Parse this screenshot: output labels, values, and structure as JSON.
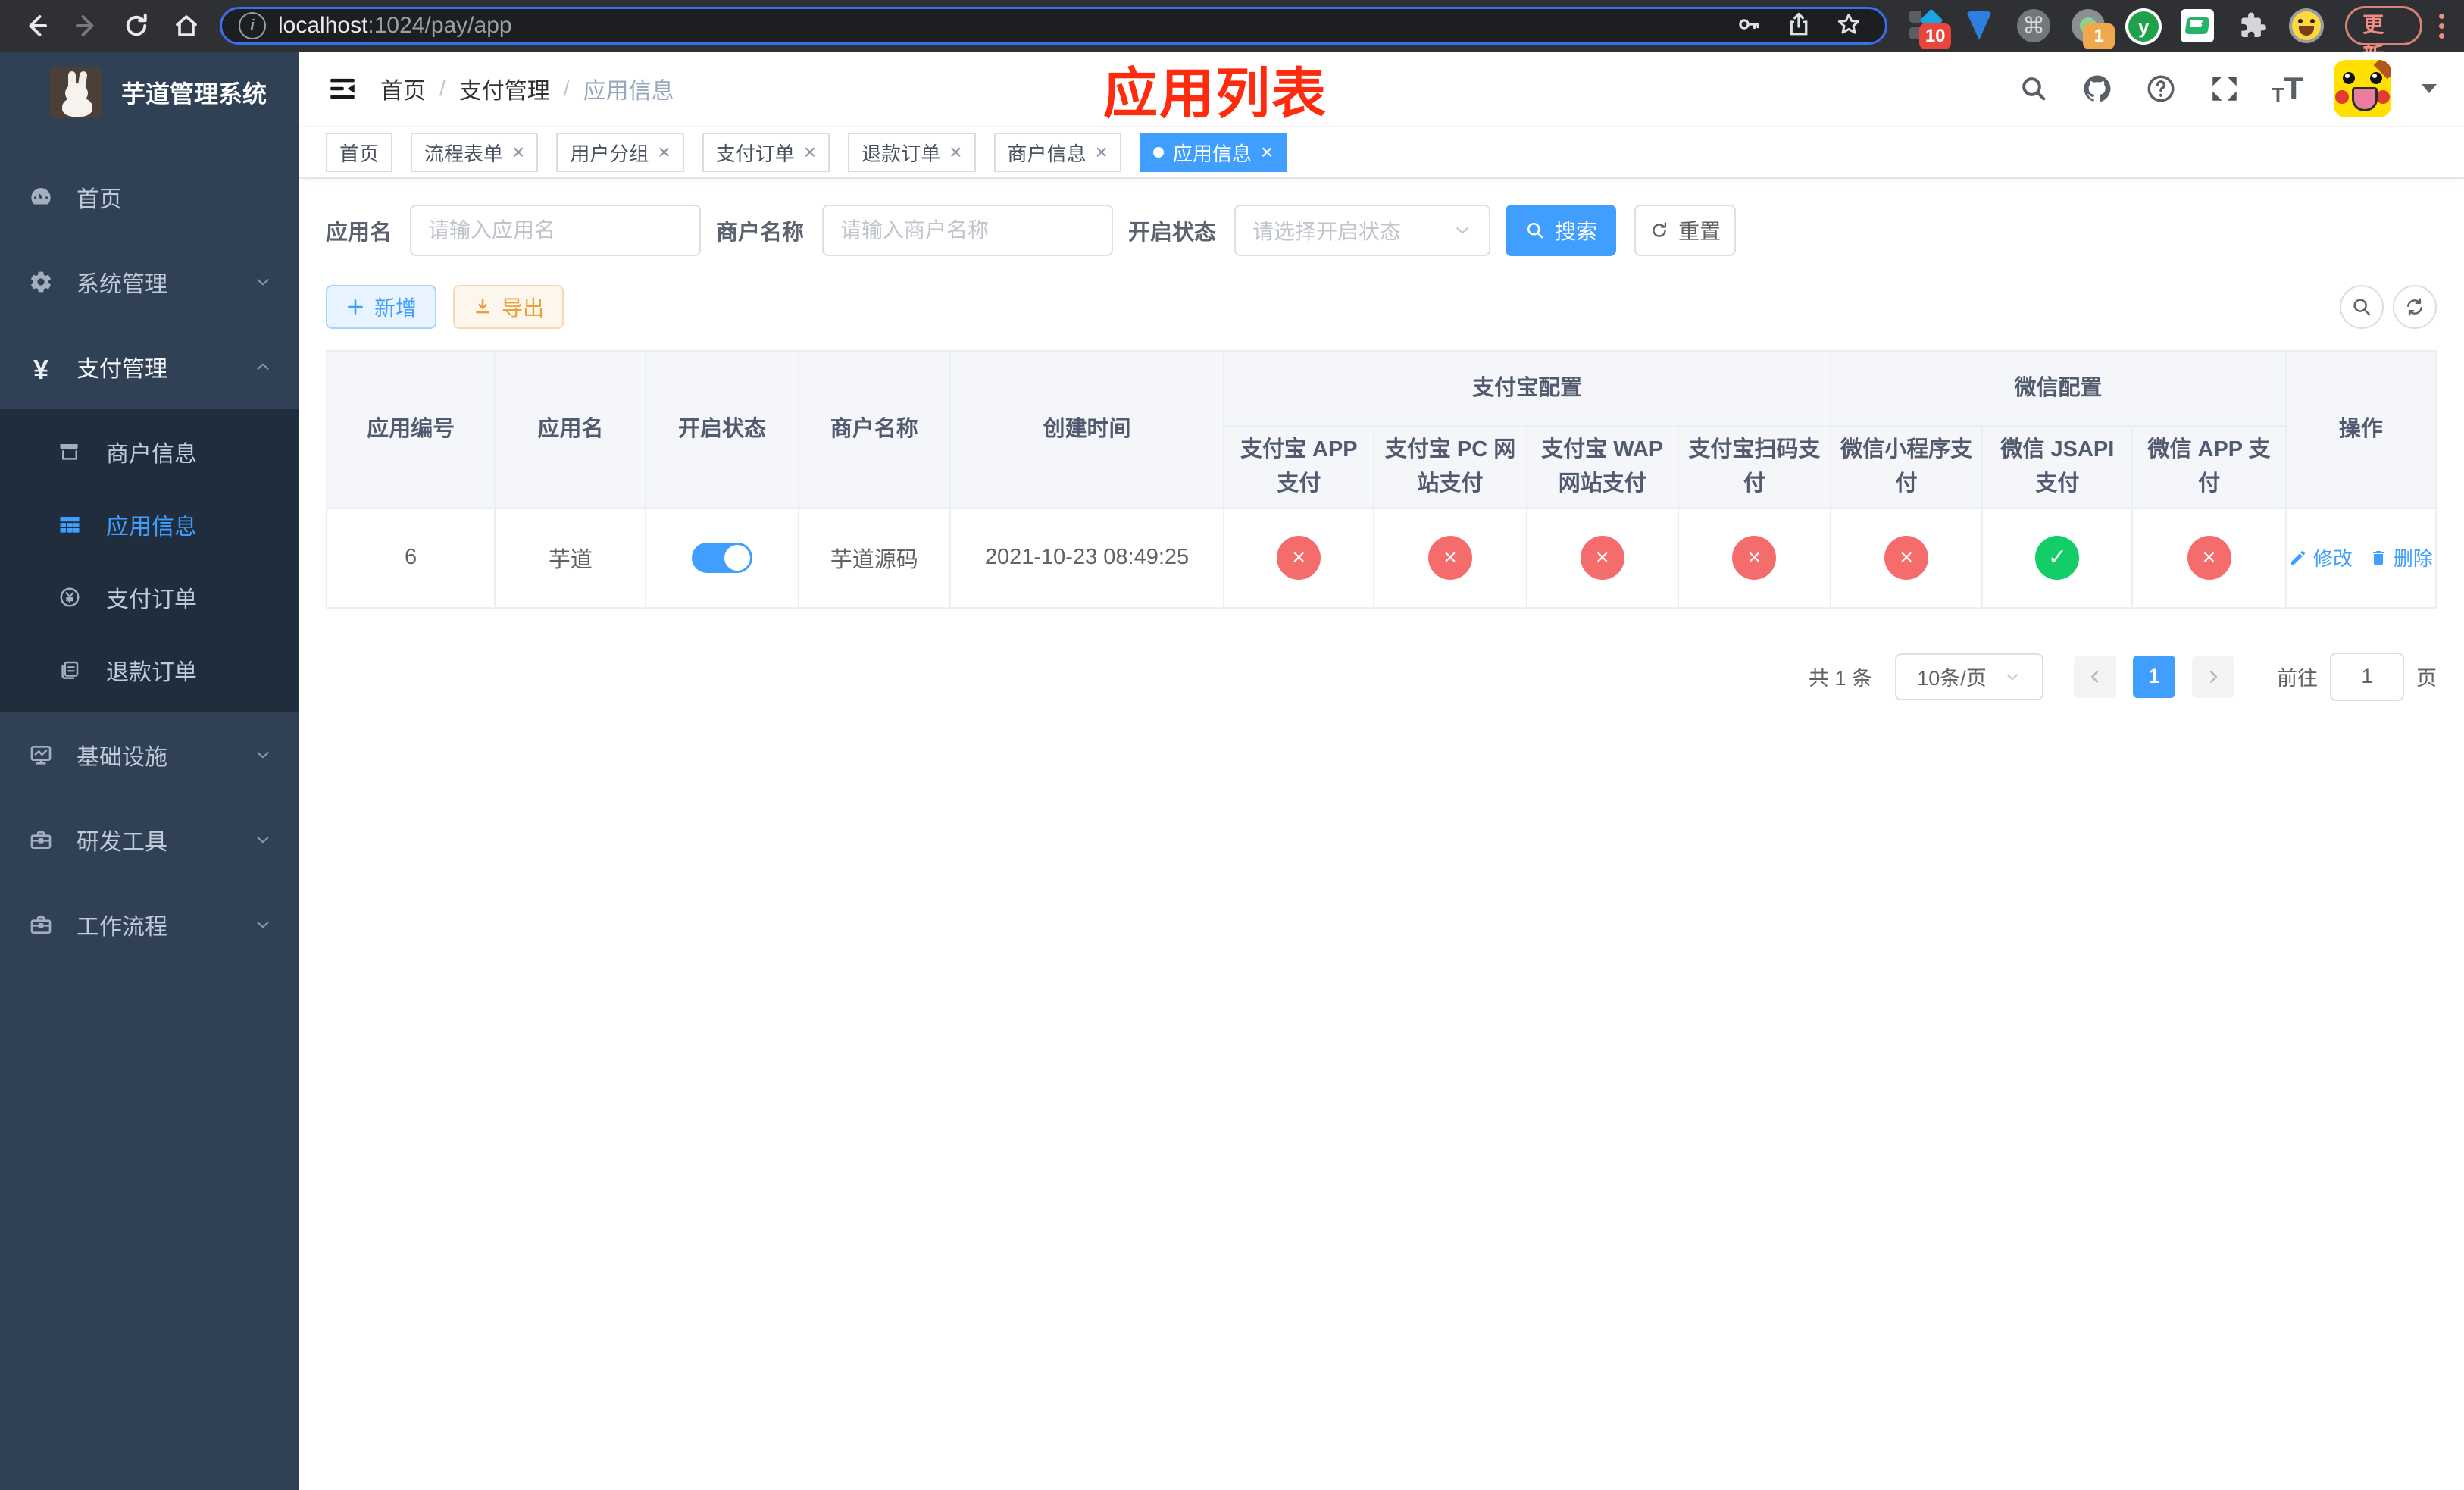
{
  "browser": {
    "url_host": "localhost",
    "url_path": ":1024/pay/app",
    "update_label": "更新",
    "ext_badge_sidekick": "10",
    "ext_badge_dot": "1",
    "ext_y_letter": "y",
    "cmd_glyph": "⌘",
    "info_glyph": "i"
  },
  "sidebar": {
    "title": "芋道管理系统",
    "items": [
      {
        "label": "首页"
      },
      {
        "label": "系统管理"
      },
      {
        "label": "支付管理"
      }
    ],
    "submenu": [
      {
        "label": "商户信息"
      },
      {
        "label": "应用信息"
      },
      {
        "label": "支付订单"
      },
      {
        "label": "退款订单"
      }
    ],
    "items_bottom": [
      {
        "label": "基础设施"
      },
      {
        "label": "研发工具"
      },
      {
        "label": "工作流程"
      }
    ],
    "yen_glyph": "¥"
  },
  "header": {
    "breadcrumb": [
      {
        "label": "首页"
      },
      {
        "label": "支付管理"
      },
      {
        "label": "应用信息"
      }
    ],
    "separator": "/",
    "annotation": "应用列表"
  },
  "tabs": [
    {
      "label": "首页"
    },
    {
      "label": "流程表单"
    },
    {
      "label": "用户分组"
    },
    {
      "label": "支付订单"
    },
    {
      "label": "退款订单"
    },
    {
      "label": "商户信息"
    },
    {
      "label": "应用信息"
    }
  ],
  "close_glyph": "×",
  "filters": {
    "app_name_label": "应用名",
    "app_name_placeholder": "请输入应用名",
    "merchant_label": "商户名称",
    "merchant_placeholder": "请输入商户名称",
    "status_label": "开启状态",
    "status_placeholder": "请选择开启状态",
    "search_label": "搜索",
    "reset_label": "重置"
  },
  "toolbar": {
    "add_label": "新增",
    "export_label": "导出"
  },
  "table": {
    "headers": {
      "id": "应用编号",
      "name": "应用名",
      "status": "开启状态",
      "merchant": "商户名称",
      "created": "创建时间",
      "alipay_group": "支付宝配置",
      "wechat_group": "微信配置",
      "actions": "操作",
      "sub": [
        {
          "label": "支付宝 APP 支付"
        },
        {
          "label": "支付宝 PC 网站支付"
        },
        {
          "label": "支付宝 WAP 网站支付"
        },
        {
          "label": "支付宝扫码支付"
        },
        {
          "label": "微信小程序支付"
        },
        {
          "label": "微信 JSAPI 支付"
        },
        {
          "label": "微信 APP 支付"
        }
      ]
    },
    "row": {
      "id": "6",
      "name": "芋道",
      "toggle": "on",
      "merchant": "芋道源码",
      "created": "2021-10-23 08:49:25",
      "configs": [
        {
          "state": "off",
          "glyph": "×"
        },
        {
          "state": "off",
          "glyph": "×"
        },
        {
          "state": "off",
          "glyph": "×"
        },
        {
          "state": "off",
          "glyph": "×"
        },
        {
          "state": "off",
          "glyph": "×"
        },
        {
          "state": "on",
          "glyph": "✓"
        },
        {
          "state": "off",
          "glyph": "×"
        }
      ],
      "edit_label": "修改",
      "delete_label": "删除"
    }
  },
  "pagination": {
    "total": "共 1 条",
    "page_size": "10条/页",
    "page": "1",
    "goto_prefix": "前往",
    "goto_value": "1",
    "goto_suffix": "页"
  },
  "colors": {
    "primary": "#409eff",
    "danger": "#f56c6c",
    "success": "#13ce66",
    "annotation_red": "#fe2b0e",
    "sidebar_bg": "#304156",
    "submenu_bg": "#1f2d3d"
  }
}
